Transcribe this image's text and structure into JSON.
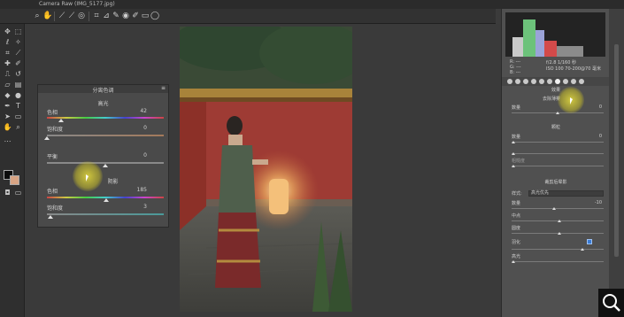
{
  "window": {
    "title": "Camera Raw (IMG_5177.jpg)"
  },
  "toolbar": {
    "icons": [
      "zoom-icon",
      "hand-icon",
      "eyedropper-icon",
      "color-sampler-icon",
      "target-icon",
      "crop-icon",
      "straighten-icon",
      "spot-removal-icon",
      "redeye-icon",
      "brush-icon",
      "graduated-filter-icon",
      "radial-filter-icon",
      "rotate-icon"
    ]
  },
  "split_toning": {
    "title": "分离色调",
    "highlights": {
      "title": "高光",
      "hue_label": "色相",
      "hue_value": "42",
      "hue_level": 0.12,
      "sat_label": "饱和度",
      "sat_value": "0",
      "sat_level": 0.0
    },
    "balance": {
      "label": "平衡",
      "value": "0",
      "level": 0.5
    },
    "shadows": {
      "title": "阴影",
      "hue_label": "色相",
      "hue_value": "185",
      "hue_level": 0.51,
      "sat_label": "饱和度",
      "sat_value": "3",
      "sat_level": 0.03
    }
  },
  "right_panel": {
    "info": {
      "r_label": "R:",
      "g_label": "G:",
      "b_label": "B:",
      "r_value": "---",
      "g_value": "---",
      "b_value": "---",
      "exposure": "f/2.8  1/160 秒",
      "iso": "ISO 100  70-200@70 毫米"
    },
    "section_effects": "效果",
    "section_grain": "颗粒",
    "section_vignette": "裁剪后晕影",
    "dehaze": {
      "label": "去除薄雾",
      "value": "0"
    },
    "amount1": {
      "label": "数量",
      "value": "0"
    },
    "grain_amount": {
      "label": "数量",
      "value": "0"
    },
    "grain_size": {
      "label": "",
      "value": ""
    },
    "grain_rough": {
      "label": "粗糙度",
      "value": ""
    },
    "style": {
      "label": "样式:",
      "value": "高光优先"
    },
    "vig_amount": {
      "label": "数量",
      "value": "-10"
    },
    "midpoint": {
      "label": "中点",
      "value": ""
    },
    "roundness": {
      "label": "圆度",
      "value": ""
    },
    "feather": {
      "label": "羽化",
      "value": ""
    },
    "highlights": {
      "label": "高光",
      "value": ""
    }
  },
  "colors": {
    "foreground": "#0c0c0c",
    "background": "#d8a484",
    "highlight_cursor": "#e6dc3c"
  }
}
